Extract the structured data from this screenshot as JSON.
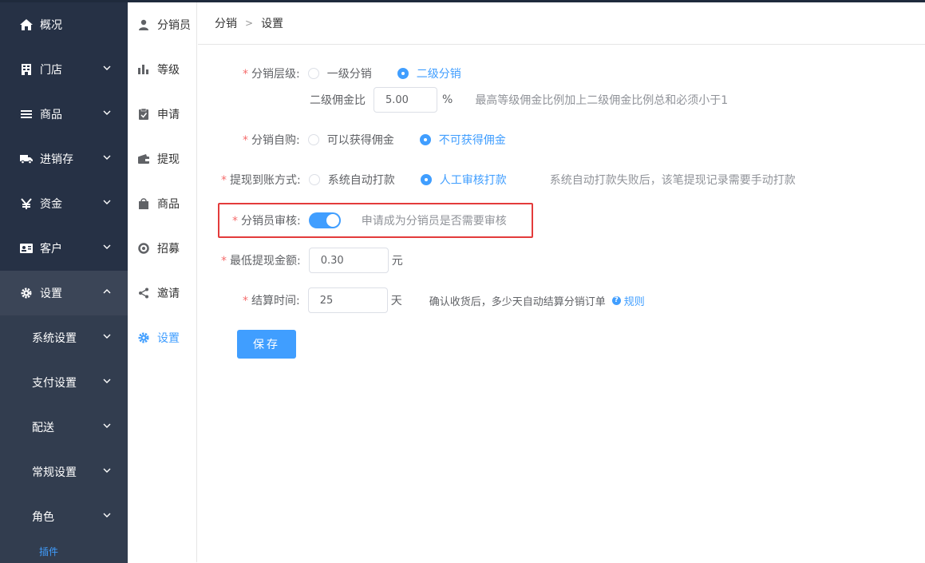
{
  "sidebar": {
    "items": [
      {
        "label": "概况",
        "icon": "home-icon"
      },
      {
        "label": "门店",
        "icon": "store-icon"
      },
      {
        "label": "商品",
        "icon": "list-icon"
      },
      {
        "label": "进销存",
        "icon": "truck-icon"
      },
      {
        "label": "资金",
        "icon": "yen-icon"
      },
      {
        "label": "客户",
        "icon": "id-card-icon"
      },
      {
        "label": "设置",
        "icon": "gear-icon"
      }
    ],
    "sub_items": [
      {
        "label": "系统设置"
      },
      {
        "label": "支付设置"
      },
      {
        "label": "配送"
      },
      {
        "label": "常规设置"
      },
      {
        "label": "角色"
      }
    ],
    "plugin_label": "插件"
  },
  "sidebar2": {
    "items": [
      {
        "label": "分销员",
        "icon": "user-icon"
      },
      {
        "label": "等级",
        "icon": "bar-chart-icon"
      },
      {
        "label": "申请",
        "icon": "clipboard-icon"
      },
      {
        "label": "提现",
        "icon": "wallet-icon"
      },
      {
        "label": "商品",
        "icon": "bag-icon"
      },
      {
        "label": "招募",
        "icon": "ring-icon"
      },
      {
        "label": "邀请",
        "icon": "share-icon"
      },
      {
        "label": "设置",
        "icon": "gear-icon"
      }
    ]
  },
  "breadcrumb": {
    "parent": "分销",
    "separator": ">",
    "current": "设置"
  },
  "form": {
    "level": {
      "label": "分销层级:",
      "options": [
        "一级分销",
        "二级分销"
      ],
      "selected": "二级分销"
    },
    "commission": {
      "label": "二级佣金比",
      "value": "5.00",
      "unit": "%",
      "hint": "最高等级佣金比例加上二级佣金比例总和必须小于1"
    },
    "self_purchase": {
      "label": "分销自购:",
      "options": [
        "可以获得佣金",
        "不可获得佣金"
      ],
      "selected": "不可获得佣金"
    },
    "withdraw_method": {
      "label": "提现到账方式:",
      "options": [
        "系统自动打款",
        "人工审核打款"
      ],
      "selected": "人工审核打款",
      "hint": "系统自动打款失败后，该笔提现记录需要手动打款"
    },
    "review": {
      "label": "分销员审核:",
      "enabled": true,
      "hint": "申请成为分销员是否需要审核"
    },
    "min_withdraw": {
      "label": "最低提现金额:",
      "value": "0.30",
      "unit": "元"
    },
    "settle_time": {
      "label": "结算时间:",
      "value": "25",
      "unit": "天",
      "hint": "确认收货后，多少天自动结算分销订单",
      "help_icon": "?",
      "link": "规则"
    },
    "required_mark": "*",
    "save_label": "保存"
  },
  "colors": {
    "accent": "#409eff",
    "sidebar": "#263145",
    "highlight_box": "#e33b3b",
    "required": "#f56c6c"
  }
}
